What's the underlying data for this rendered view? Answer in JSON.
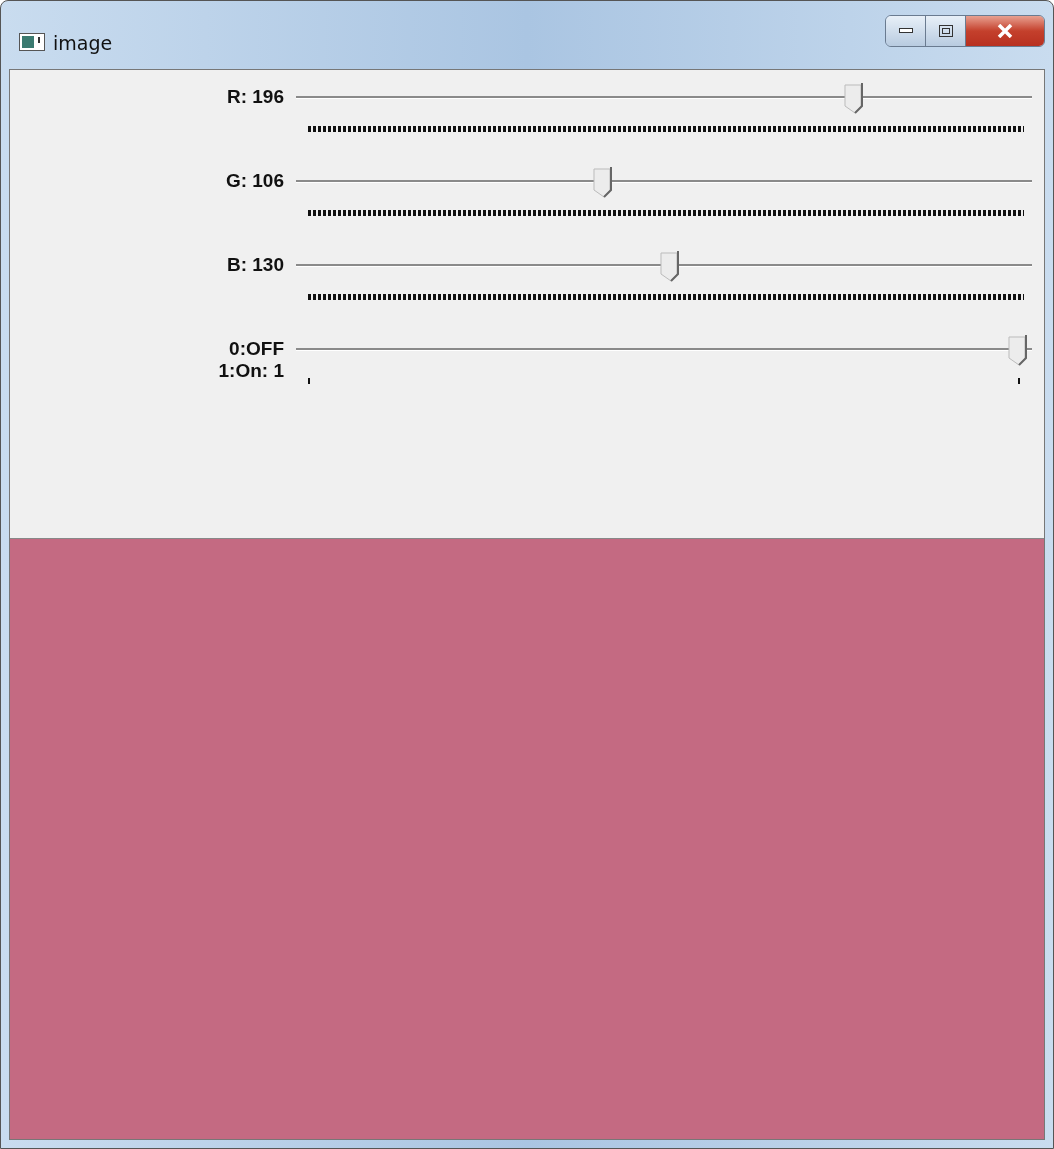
{
  "window": {
    "title": "image"
  },
  "trackbars": [
    {
      "kind": "slider",
      "label": "R: 196",
      "level": 0.7686
    },
    {
      "kind": "slider",
      "label": "G: 106",
      "level": 0.4157
    },
    {
      "kind": "slider",
      "label": "B: 130",
      "level": 0.5098
    },
    {
      "kind": "switch",
      "label": "0:OFF\n1:On: 1",
      "level": 1
    }
  ]
}
